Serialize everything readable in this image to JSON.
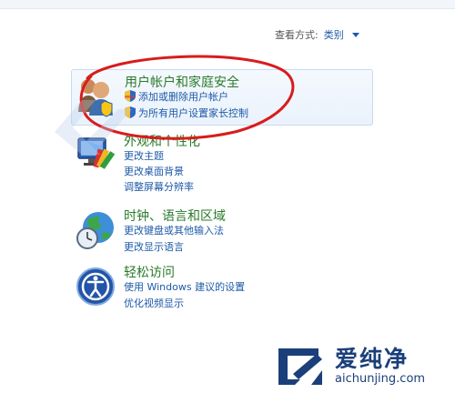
{
  "header": {
    "view_by_label": "查看方式:",
    "view_by_value": "类别"
  },
  "categories": [
    {
      "title": "用户帐户和家庭安全",
      "icon": "users-icon",
      "links": [
        "添加或删除用户帐户",
        "为所有用户设置家长控制"
      ]
    },
    {
      "title": "外观和个性化",
      "icon": "appearance-icon",
      "links": [
        "更改主题",
        "更改桌面背景",
        "调整屏幕分辨率"
      ]
    },
    {
      "title": "时钟、语言和区域",
      "icon": "clock-globe-icon",
      "links": [
        "更改键盘或其他输入法",
        "更改显示语言"
      ]
    },
    {
      "title": "轻松访问",
      "icon": "ease-of-access-icon",
      "links": [
        "使用 Windows 建议的设置",
        "优化视频显示"
      ]
    }
  ],
  "logo": {
    "name": "爱纯净",
    "url": "aichunjing.com"
  },
  "colors": {
    "category_title": "#2a7a2a",
    "link": "#1e5aa8",
    "annotation_ellipse": "#d81c1c",
    "logo": "#1b3f7a"
  }
}
